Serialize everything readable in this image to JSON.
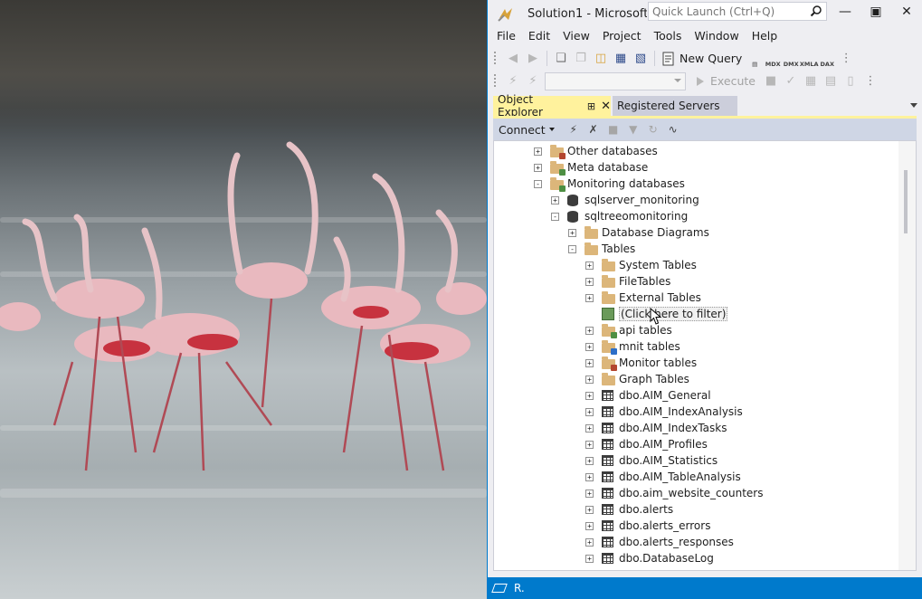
{
  "window": {
    "title": "Solution1 - Microsoft S...",
    "quick_launch_placeholder": "Quick Launch (Ctrl+Q)"
  },
  "menu": [
    "File",
    "Edit",
    "View",
    "Project",
    "Tools",
    "Window",
    "Help"
  ],
  "toolbar": {
    "new_query_label": "New Query",
    "query_types": [
      "MDX",
      "DMX",
      "XMLA",
      "DAX"
    ],
    "execute_label": "Execute"
  },
  "tabs": {
    "object_explorer": "Object Explorer",
    "registered_servers": "Registered Servers"
  },
  "oe_toolbar": {
    "connect_label": "Connect"
  },
  "tree": [
    {
      "label": "Other databases",
      "level": 2,
      "expander": "+",
      "icon": "folder-red-icon"
    },
    {
      "label": "Meta database",
      "level": 2,
      "expander": "+",
      "icon": "folder-green-icon"
    },
    {
      "label": "Monitoring databases",
      "level": 2,
      "expander": "-",
      "icon": "folder-green-icon"
    },
    {
      "label": "sqlserver_monitoring",
      "level": 3,
      "expander": "+",
      "icon": "database-icon"
    },
    {
      "label": "sqltreeomonitoring",
      "level": 3,
      "expander": "-",
      "icon": "database-icon"
    },
    {
      "label": "Database Diagrams",
      "level": 4,
      "expander": "+",
      "icon": "folder-icon"
    },
    {
      "label": "Tables",
      "level": 4,
      "expander": "-",
      "icon": "folder-icon"
    },
    {
      "label": "System Tables",
      "level": 5,
      "expander": "+",
      "icon": "folder-icon"
    },
    {
      "label": "FileTables",
      "level": 5,
      "expander": "+",
      "icon": "folder-icon"
    },
    {
      "label": "External Tables",
      "level": 5,
      "expander": "+",
      "icon": "folder-icon"
    },
    {
      "label": "(Click here to filter)",
      "level": 5,
      "expander": "",
      "icon": "filter-icon"
    },
    {
      "label": "api tables",
      "level": 5,
      "expander": "+",
      "icon": "folder-green-icon"
    },
    {
      "label": "mnit tables",
      "level": 5,
      "expander": "+",
      "icon": "folder-blue-icon"
    },
    {
      "label": "Monitor tables",
      "level": 5,
      "expander": "+",
      "icon": "folder-red-icon"
    },
    {
      "label": "Graph Tables",
      "level": 5,
      "expander": "+",
      "icon": "folder-icon"
    },
    {
      "label": "dbo.AIM_General",
      "level": 5,
      "expander": "+",
      "icon": "table-icon"
    },
    {
      "label": "dbo.AIM_IndexAnalysis",
      "level": 5,
      "expander": "+",
      "icon": "table-icon"
    },
    {
      "label": "dbo.AIM_IndexTasks",
      "level": 5,
      "expander": "+",
      "icon": "table-icon"
    },
    {
      "label": "dbo.AIM_Profiles",
      "level": 5,
      "expander": "+",
      "icon": "table-icon"
    },
    {
      "label": "dbo.AIM_Statistics",
      "level": 5,
      "expander": "+",
      "icon": "table-icon"
    },
    {
      "label": "dbo.AIM_TableAnalysis",
      "level": 5,
      "expander": "+",
      "icon": "table-icon"
    },
    {
      "label": "dbo.aim_website_counters",
      "level": 5,
      "expander": "+",
      "icon": "table-icon"
    },
    {
      "label": "dbo.alerts",
      "level": 5,
      "expander": "+",
      "icon": "table-icon"
    },
    {
      "label": "dbo.alerts_errors",
      "level": 5,
      "expander": "+",
      "icon": "table-icon"
    },
    {
      "label": "dbo.alerts_responses",
      "level": 5,
      "expander": "+",
      "icon": "table-icon"
    },
    {
      "label": "dbo.DatabaseLog",
      "level": 5,
      "expander": "+",
      "icon": "table-icon"
    }
  ],
  "status": {
    "text": "R."
  },
  "colors": {
    "accent": "#007acc",
    "active_tab": "#fff29d",
    "inactive_tab": "#cccedb",
    "oe_toolbar": "#cfd6e5"
  }
}
